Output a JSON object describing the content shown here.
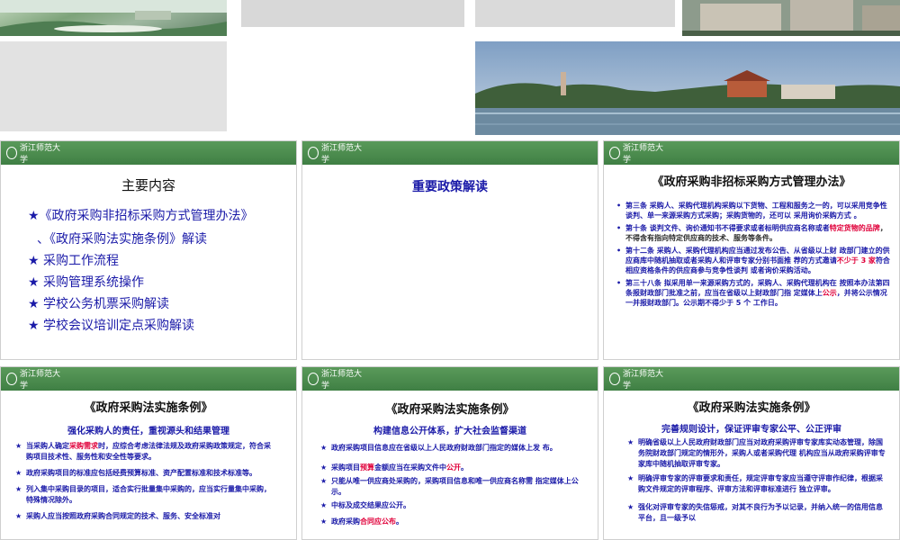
{
  "colors": {
    "slide_bar_top": "#5a9a5a",
    "slide_bar_bottom": "#3f7f44",
    "link_blue": "#1a1aa8",
    "highlight_red": "#e0003a"
  },
  "logo_text": "浙江师范大学",
  "slide1": {
    "title": "主要内容",
    "items": [
      "★《政府采购非招标采购方式管理办法》",
      "、《政府采购法实施条例》解读",
      "★   采购工作流程",
      "★   采购管理系统操作",
      "★   学校公务机票采购解读",
      "★   学校会议培训定点采购解读"
    ]
  },
  "slide2": {
    "title": "重要政策解读"
  },
  "slide3": {
    "title": "《政府采购非招标采购方式管理办法》",
    "p1": "第三条  采购人、采购代理机构采购以下货物、工程和服务之一的，可以采用竞争性谈判、单一来源采购方式采购；采购货物的，还可以 采用询价采购方式 。",
    "p2a": "第十条  谈判文件、询价通知书不得要求或者标明供应商名称或者",
    "p2b": "特定货物的品牌",
    "p2c": "，不得含有指向特定供应商的技术、服务等条件。",
    "p3a": "第十二条    采购人、采购代理机构应当通过发布公告、从省级以上财 政部门建立的供应商库中随机抽取或者采购人和评审专家分别书面推 荐的方式邀请",
    "p3b": "不少于 3 家",
    "p3c": "符合相应资格条件的供应商参与竞争性谈判 或者询价采购活动。",
    "p4a": "第三十八条    拟采用单一来源采购方式的，采购人、采购代理机构在 按照本办法第四条报财政部门批准之前，应当在省级以上财政部门指 定媒体上",
    "p4b": "公示",
    "p4c": "，并将公示情况一并报财政部门。公示期不得少于 5 个 工作日。"
  },
  "slide4": {
    "title": "《政府采购法实施条例》",
    "subtitle": "强化采购人的责任，重视源头和结果管理",
    "b1a": "当采购人确定",
    "b1b": "采购需求",
    "b1c": "时，应综合考虑法律法规及政府采购政策规定，符合采购项目技术性、服务性和安全性等要求。",
    "b2": "政府采购项目的标准应包括经费预算标准、资产配置标准和技术标准等。",
    "b3": "列入集中采购目录的项目，适合实行批量集中采购的，应当实行量集中采购，特殊情况除外。",
    "b4": "采购人应当按照政府采购合同规定的技术、服务、安全标准对"
  },
  "slide5": {
    "title": "《政府采购法实施条例》",
    "subtitle": "构建信息公开体系，扩大社会监督渠道",
    "b1": "政府采购项目信息应在省级以上人民政府财政部门指定的媒体上发 布。",
    "b2a": "采购项目",
    "b2b": "预算",
    "b2c": "金额应当在采购文件中",
    "b2d": "公开",
    "b2e": "。",
    "b3": "只能从唯一供应商处采购的，采购项目信息和唯一供应商名称需 指定媒体上公示。",
    "b4": "中标及成交结果应公开。",
    "b5a": "政府采购",
    "b5b": "合同应公布",
    "b5c": "。"
  },
  "slide6": {
    "title": "《政府采购法实施条例》",
    "subtitle": "完善规则设计，保证评审专家公平、公正评审",
    "b1": "明确省级以上人民政府财政部门应当对政府采购评审专家库实动态管理，除国务院财政部门规定的情形外，采购人或者采购代理 机构应当从政府采购评审专家库中随机抽取评审专家。",
    "b2": "明确评审专家的评审要求和责任，规定评审专家应当遵守评审作纪律，根据采购文件规定的评审程序、评审方法和评审标准进行 独立评审。",
    "b3": "强化对评审专家的失信惩戒，对其不良行为予以记录，并纳入统一的信用信息平台，且一级予以"
  }
}
